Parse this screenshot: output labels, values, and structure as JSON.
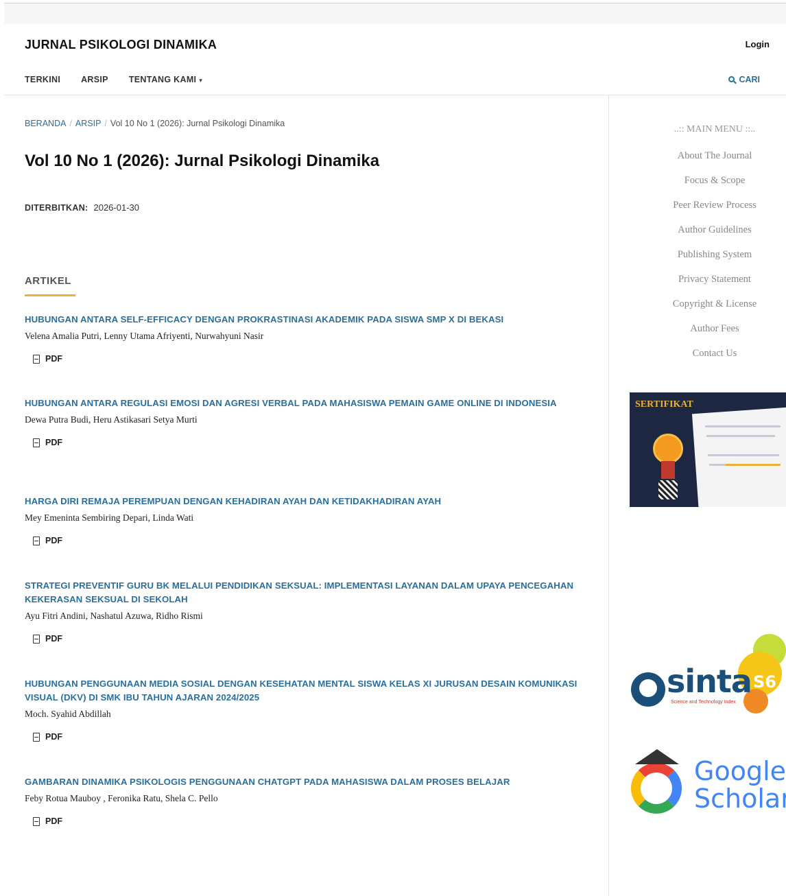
{
  "header": {
    "site_title": "JURNAL PSIKOLOGI DINAMIKA",
    "login_label": "Login",
    "nav": [
      {
        "label": "TERKINI"
      },
      {
        "label": "ARSIP"
      },
      {
        "label": "TENTANG KAMI"
      }
    ],
    "nav_dropdown_caret": "▾",
    "search_label": "CARI"
  },
  "breadcrumb": {
    "items": [
      "BERANDA",
      "ARSIP",
      "Vol 10 No 1 (2026): Jurnal Psikologi Dinamika"
    ],
    "separator": "/"
  },
  "issue": {
    "title": "Vol 10 No 1 (2026): Jurnal Psikologi Dinamika",
    "published_label": "DITERBITKAN:",
    "published_date": "2026-01-30"
  },
  "section": {
    "heading": "ARTIKEL"
  },
  "articles": [
    {
      "title": "HUBUNGAN ANTARA SELF-EFFICACY DENGAN PROKRASTINASI AKADEMIK PADA SISWA SMP X DI BEKASI",
      "authors": "Velena Amalia Putri, Lenny Utama Afriyenti, Nurwahyuni Nasir",
      "galley": "PDF"
    },
    {
      "title": "HUBUNGAN ANTARA REGULASI EMOSI DAN AGRESI VERBAL PADA MAHASISWA PEMAIN GAME ONLINE DI INDONESIA",
      "authors": "Dewa Putra Budi, Heru Astikasari Setya Murti",
      "galley": "PDF"
    },
    {
      "title": "HARGA DIRI REMAJA PEREMPUAN DENGAN KEHADIRAN AYAH DAN KETIDAKHADIRAN AYAH",
      "authors": "Mey Emeninta Sembiring Depari, Linda Wati",
      "galley": "PDF"
    },
    {
      "title": "STRATEGI PREVENTIF GURU BK MELALUI PENDIDIKAN SEKSUAL: IMPLEMENTASI LAYANAN DALAM UPAYA PENCEGAHAN KEKERASAN SEKSUAL DI SEKOLAH",
      "authors": "Ayu Fitri Andini, Nashatul Azuwa, Ridho Rismi",
      "galley": "PDF"
    },
    {
      "title": "HUBUNGAN PENGGUNAAN MEDIA SOSIAL DENGAN KESEHATAN MENTAL SISWA KELAS XI JURUSAN DESAIN KOMUNIKASI VISUAL (DKV) DI SMK IBU TAHUN AJARAN 2024/2025",
      "authors": "Moch. Syahid Abdillah",
      "galley": "PDF"
    },
    {
      "title": "GAMBARAN DINAMIKA PSIKOLOGIS PENGGUNAAN CHATGPT PADA MAHASISWA DALAM PROSES BELAJAR",
      "authors": "Feby Rotua Mauboy , Feronika Ratu, Shela C. Pello",
      "galley": "PDF"
    }
  ],
  "sidebar": {
    "menu_heading": "..:: MAIN MENU ::..",
    "menu_items": [
      "About The Journal",
      "Focus & Scope",
      "Peer Review Process",
      "Author Guidelines",
      "Publishing System",
      "Privacy Statement",
      "Copyright & License",
      "Author Fees",
      "Contact Us"
    ],
    "certificate_title": "SERTIFIKAT",
    "sinta_logo_text": "sinta",
    "sinta_badge": "S6",
    "sinta_tagline": "Science and Technology Index",
    "google_scholar_text": "Google Scholar"
  },
  "colors": {
    "link": "#2a6f9e",
    "accent_underline": "#e8b13a",
    "sidebar_text": "#888888"
  },
  "icons": {
    "search": "search-icon",
    "pdf": "file-pdf-icon",
    "dropdown": "chevron-down-icon"
  }
}
